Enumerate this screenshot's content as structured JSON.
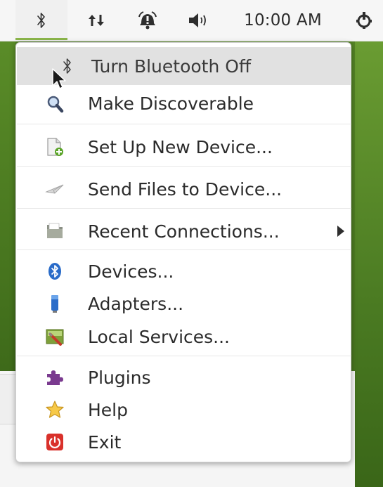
{
  "panel": {
    "clock": "10:00 AM",
    "indicators": [
      {
        "name": "bluetooth-icon",
        "glyph": "bluetooth"
      },
      {
        "name": "network-icon",
        "glyph": "network-updown"
      },
      {
        "name": "alarm-icon",
        "glyph": "alarm"
      },
      {
        "name": "volume-icon",
        "glyph": "speaker"
      },
      {
        "name": "power-icon",
        "glyph": "power"
      }
    ]
  },
  "menu": {
    "items": [
      {
        "label": "Turn Bluetooth Off",
        "icon": "bluetooth-icon",
        "highlighted": true
      },
      {
        "label": "Make Discoverable",
        "icon": "search-icon"
      },
      {
        "label": "Set Up New Device...",
        "icon": "new-document-icon"
      },
      {
        "label": "Send Files to Device...",
        "icon": "send-icon"
      },
      {
        "label": "Recent Connections...",
        "icon": "folder-icon",
        "submenu": true
      },
      {
        "label": "Devices...",
        "icon": "bluetooth-badge-icon"
      },
      {
        "label": "Adapters...",
        "icon": "usb-adapter-icon"
      },
      {
        "label": "Local Services...",
        "icon": "services-icon"
      },
      {
        "label": "Plugins",
        "icon": "puzzle-icon"
      },
      {
        "label": "Help",
        "icon": "star-icon"
      },
      {
        "label": "Exit",
        "icon": "exit-icon"
      }
    ]
  },
  "colors": {
    "accent": "#8bb54a",
    "desktop": "#5e9029",
    "menu_bg": "#ffffff",
    "highlight": "#e1e1e1"
  }
}
